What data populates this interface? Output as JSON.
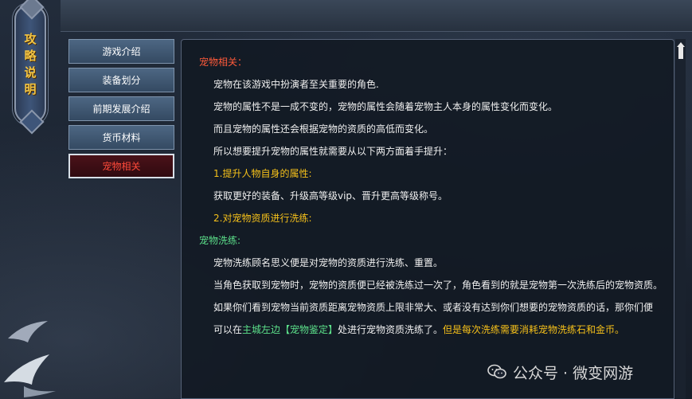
{
  "title_plaque": {
    "chars": [
      "攻",
      "略",
      "说",
      "明"
    ]
  },
  "nav": {
    "items": [
      {
        "label": "游戏介绍",
        "active": false
      },
      {
        "label": "装备划分",
        "active": false
      },
      {
        "label": "前期发展介绍",
        "active": false
      },
      {
        "label": "货币材料",
        "active": false
      },
      {
        "label": "宠物相关",
        "active": true
      }
    ]
  },
  "content": {
    "heading1": "宠物相关：",
    "p1": "宠物在该游戏中扮演者至关重要的角色.",
    "p2": "宠物的属性不是一成不变的，宠物的属性会随着宠物主人本身的属性变化而变化。",
    "p3": "而且宠物的属性还会根据宠物的资质的高低而变化。",
    "p4": "所以想要提升宠物的属性就需要从以下两方面着手提升：",
    "item1": "1.提升人物自身的属性:",
    "item1_desc": "获取更好的装备、升级高等级vip、晋升更高等级称号。",
    "item2": "2.对宠物资质进行洗练:",
    "heading2": "宠物洗练:",
    "p5": "宠物洗练顾名思义便是对宠物的资质进行洗练、重置。",
    "p6": "当角色获取到宠物时，宠物的资质便已经被洗练过一次了，角色看到的就是宠物第一次洗练后的宠物资质。",
    "p7": "如果你们看到宠物当前资质距离宠物资质上限非常大、或者没有达到你们想要的宠物资质的话，那你们便",
    "p8_a": "可以在",
    "p8_link": "主城左边【宠物鉴定】",
    "p8_b": "处进行宠物资质洗练了。",
    "p8_note": "但是每次洗练需要消耗宠物洗练石和金币。"
  },
  "watermark": {
    "text": "公众号 · 微变网游",
    "icon": "wechat-icon"
  },
  "colors": {
    "red": "#ff5a3a",
    "yellow": "#f5c01a",
    "green": "#5ce08a",
    "gold": "#f2c444"
  }
}
